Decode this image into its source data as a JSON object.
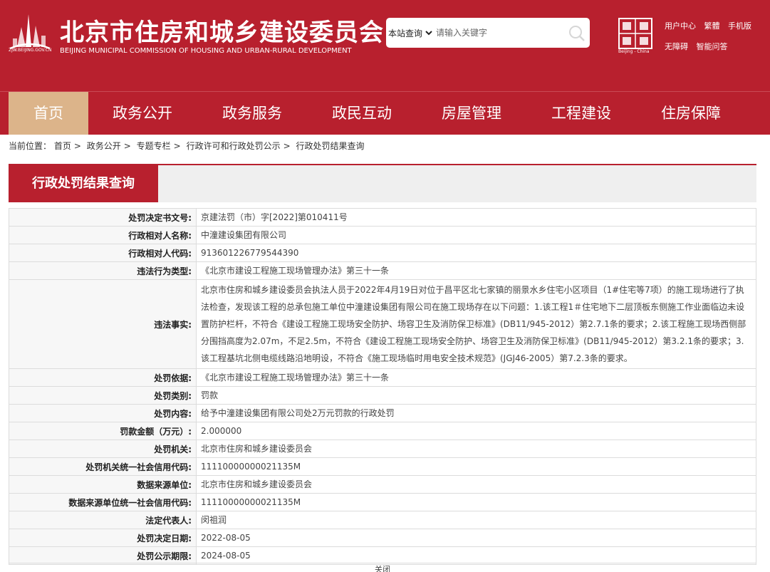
{
  "header": {
    "logo_url_text": "ZJW.BEIJING.GOV.CN",
    "title": "北京市住房和城乡建设委员会",
    "subtitle": "BEIJING MUNICIPAL COMMISSION OF HOUSING AND URBAN-RURAL DEVELOPMENT",
    "search": {
      "scope": "本站查询",
      "placeholder": "请输入关键字"
    },
    "capital_text": "Beijing - China",
    "links_row1": [
      "用户中心",
      "繁體",
      "手机版"
    ],
    "links_row2": [
      "无障碍",
      "智能问答"
    ]
  },
  "nav": {
    "items": [
      "首页",
      "政务公开",
      "政务服务",
      "政民互动",
      "房屋管理",
      "工程建设",
      "住房保障"
    ],
    "active_index": 0
  },
  "breadcrumb": {
    "prefix": "当前位置：",
    "items": [
      "首页",
      "政务公开",
      "专题专栏",
      "行政许可和行政处罚公示",
      "行政处罚结果查询"
    ]
  },
  "section_title": "行政处罚结果查询",
  "details": [
    {
      "key": "处罚决定书文号:",
      "value": "京建法罚（市）字[2022]第010411号"
    },
    {
      "key": "行政相对人名称:",
      "value": "中潼建设集团有限公司"
    },
    {
      "key": "行政相对人代码:",
      "value": "913601226779544390"
    },
    {
      "key": "违法行为类型:",
      "value": "《北京市建设工程施工现场管理办法》第三十一条"
    },
    {
      "key": "违法事实:",
      "value": "北京市住房和城乡建设委员会执法人员于2022年4月19日对位于昌平区北七家镇的丽景水乡住宅小区项目（1#住宅等7项）的施工现场进行了执法检查，发现该工程的总承包施工单位中潼建设集团有限公司在施工现场存在以下问题：1.该工程1＃住宅地下二层顶板东侧施工作业面临边未设置防护栏杆，不符合《建设工程施工现场安全防护、场容卫生及消防保卫标准》(DB11/945-2012）第2.7.1条的要求；2.该工程施工现场西侧部分围挡高度为2.07m，不足2.5m，不符合《建设工程施工现场安全防护、场容卫生及消防保卫标准》(DB11/945-2012）第3.2.1条的要求；3.该工程基坑北侧电缆线路沿地明设，不符合《施工现场临时用电安全技术规范》(JGJ46-2005）第7.2.3条的要求。"
    },
    {
      "key": "处罚依据:",
      "value": "《北京市建设工程施工现场管理办法》第三十一条"
    },
    {
      "key": "处罚类别:",
      "value": "罚款"
    },
    {
      "key": "处罚内容:",
      "value": "给予中潼建设集团有限公司处2万元罚款的行政处罚"
    },
    {
      "key": "罚款金额（万元）:",
      "value": "2.000000"
    },
    {
      "key": "处罚机关:",
      "value": "北京市住房和城乡建设委员会"
    },
    {
      "key": "处罚机关统一社会信用代码:",
      "value": "11110000000021135M"
    },
    {
      "key": "数据来源单位:",
      "value": "北京市住房和城乡建设委员会"
    },
    {
      "key": "数据来源单位统一社会信用代码:",
      "value": "11110000000021135M"
    },
    {
      "key": "法定代表人:",
      "value": "闵祖润"
    },
    {
      "key": "处罚决定日期:",
      "value": "2022-08-05"
    },
    {
      "key": "处罚公示期限:",
      "value": "2024-08-05"
    }
  ],
  "close_label": "关闭",
  "icons": {
    "logo": "beijing-skyline-logo-icon",
    "search": "search-icon",
    "chevron": "chevron-down-icon",
    "capital": "capital-seal-icon"
  },
  "colors": {
    "brand_red": "#b8202e",
    "nav_active": "#dcb48a",
    "title_bar_bg": "#efefef"
  }
}
